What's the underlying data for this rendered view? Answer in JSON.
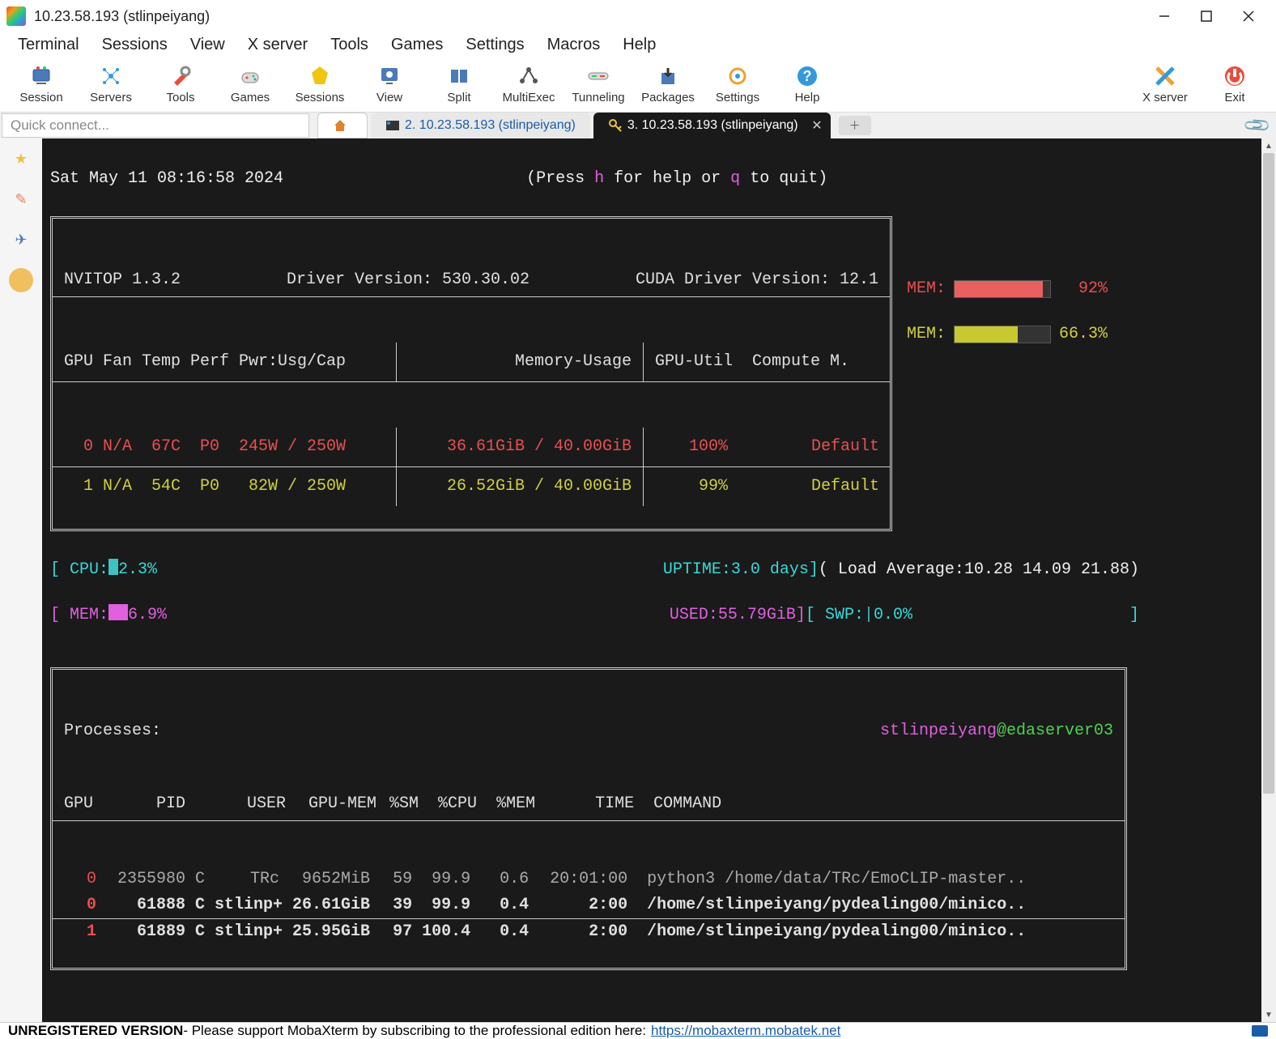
{
  "window": {
    "title": "10.23.58.193 (stlinpeiyang)"
  },
  "menu": [
    "Terminal",
    "Sessions",
    "View",
    "X server",
    "Tools",
    "Games",
    "Settings",
    "Macros",
    "Help"
  ],
  "toolbar": [
    {
      "label": "Session",
      "icon": "session"
    },
    {
      "label": "Servers",
      "icon": "servers"
    },
    {
      "label": "Tools",
      "icon": "tools"
    },
    {
      "label": "Games",
      "icon": "games"
    },
    {
      "label": "Sessions",
      "icon": "sessions"
    },
    {
      "label": "View",
      "icon": "view"
    },
    {
      "label": "Split",
      "icon": "split"
    },
    {
      "label": "MultiExec",
      "icon": "multiexec"
    },
    {
      "label": "Tunneling",
      "icon": "tunneling"
    },
    {
      "label": "Packages",
      "icon": "packages"
    },
    {
      "label": "Settings",
      "icon": "settings"
    },
    {
      "label": "Help",
      "icon": "help"
    }
  ],
  "toolbar_right": [
    {
      "label": "X server",
      "icon": "xserver"
    },
    {
      "label": "Exit",
      "icon": "exit"
    }
  ],
  "quick_connect_placeholder": "Quick connect...",
  "tabs": {
    "inactive": "2. 10.23.58.193 (stlinpeiyang)",
    "active": "3. 10.23.58.193 (stlinpeiyang)"
  },
  "terminal": {
    "timestamp": "Sat May 11 08:16:58 2024",
    "help_hint_pre": "(Press ",
    "help_key1": "h",
    "help_hint_mid": " for help or ",
    "help_key2": "q",
    "help_hint_post": " to quit)",
    "header": {
      "nvitop": "NVITOP 1.3.2",
      "driver": "Driver Version: 530.30.02",
      "cuda": "CUDA Driver Version: 12.1",
      "cols1": "GPU Fan Temp Perf Pwr:Usg/Cap",
      "cols2": "Memory-Usage",
      "cols3": "GPU-Util  Compute M."
    },
    "gpus": [
      {
        "id": "0",
        "fan": "N/A",
        "temp": "67C",
        "perf": "P0",
        "pwr": "245W / 250W",
        "mem": "36.61GiB / 40.00GiB",
        "util": "100%",
        "compute": "Default",
        "mem_label": "MEM:",
        "mem_pct": "92%",
        "mem_fill": 92,
        "color": "red"
      },
      {
        "id": "1",
        "fan": "N/A",
        "temp": "54C",
        "perf": "P0",
        "pwr": " 82W / 250W",
        "mem": "26.52GiB / 40.00GiB",
        "util": "99%",
        "compute": "Default",
        "mem_label": "MEM:",
        "mem_pct": "66.3%",
        "mem_fill": 66,
        "color": "yellow"
      }
    ],
    "system": {
      "cpu_label": "CPU:",
      "cpu_pct": "2.3%",
      "mem_label": "MEM:",
      "mem_pct": "6.9%",
      "uptime_label": "UPTIME:",
      "uptime": "3.0 days",
      "used_label": "USED:",
      "used": "55.79GiB",
      "load_label": "Load Average:",
      "load": "10.28 14.09 21.88",
      "swp_label": "SWP:",
      "swp": "0.0%"
    },
    "processes": {
      "title": "Processes:",
      "user_host": "stlinpeiyang",
      "host": "@edaserver03",
      "header": "GPU     PID       USER  GPU-MEM %SM  %CPU  %MEM     TIME  COMMAND",
      "rows": [
        {
          "gpu": "0",
          "pid": "2355980",
          "type": "C",
          "user": "TRc",
          "gpu_mem": "9652MiB",
          "sm": "59",
          "cpu": "99.9",
          "mem": "0.6",
          "time": "20:01:00",
          "cmd": "python3 /home/data/TRc/EmoCLIP-master..",
          "highlight": false
        },
        {
          "gpu": "0",
          "pid": "61888",
          "type": "C",
          "user": "stlinp+",
          "gpu_mem": "26.61GiB",
          "sm": "39",
          "cpu": "99.9",
          "mem": "0.4",
          "time": "2:00",
          "cmd": "/home/stlinpeiyang/pydealing00/minico..",
          "highlight": true
        },
        {
          "gpu": "1",
          "pid": "61889",
          "type": "C",
          "user": "stlinp+",
          "gpu_mem": "25.95GiB",
          "sm": "97",
          "cpu": "100.4",
          "mem": "0.4",
          "time": "2:00",
          "cmd": "/home/stlinpeiyang/pydealing00/minico..",
          "highlight": true
        }
      ]
    }
  },
  "statusbar": {
    "unreg": "UNREGISTERED VERSION",
    "msg": "  -  Please support MobaXterm by subscribing to the professional edition here:  ",
    "link": "https://mobaxterm.mobatek.net"
  }
}
